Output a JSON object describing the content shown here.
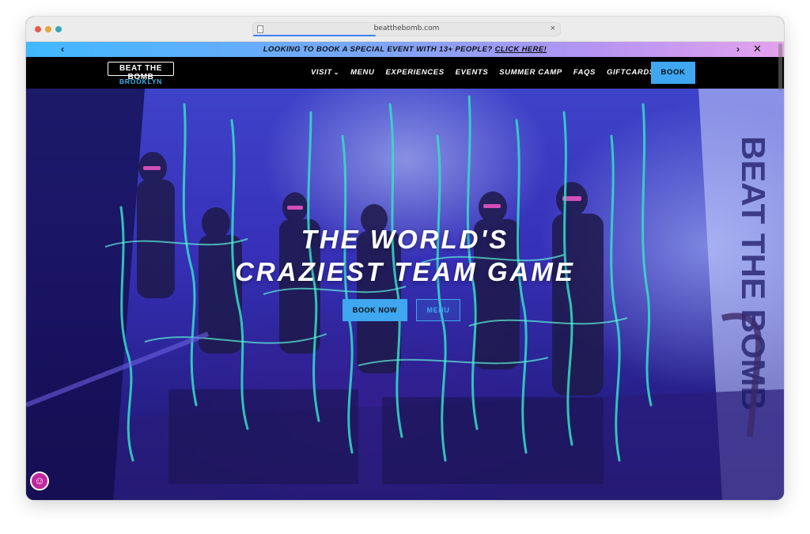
{
  "browser": {
    "url": "beatthebomb.com",
    "load_progress": 0.4
  },
  "announcement": {
    "text": "LOOKING TO BOOK A SPECIAL EVENT WITH 13+ PEOPLE?",
    "link_label": "CLICK HERE!",
    "prev_icon": "‹",
    "next_icon": "›",
    "close_icon": "✕"
  },
  "nav": {
    "logo_title": "BEAT THE BOMB",
    "logo_subtitle": "BROOKLYN",
    "items": [
      {
        "label": "VISIT",
        "has_dropdown": true
      },
      {
        "label": "MENU"
      },
      {
        "label": "EXPERIENCES"
      },
      {
        "label": "EVENTS"
      },
      {
        "label": "SUMMER CAMP"
      },
      {
        "label": "FAQS"
      },
      {
        "label": "GIFTCARDS"
      }
    ],
    "book_label": "BOOK"
  },
  "hero": {
    "title_line1": "THE WORLD'S",
    "title_line2": "CRAZIEST TEAM GAME",
    "book_now_label": "BOOK NOW",
    "menu_label": "MENU",
    "wall_text": "BEAT THE BOMB"
  },
  "colors": {
    "accent": "#3ea7ef",
    "slime": "#33e0c8",
    "hero_bg": "#3730b8",
    "accessibility": "#c0289f"
  },
  "icons": {
    "accessibility": "accessibility-icon",
    "dropdown": "chevron-down-icon"
  }
}
